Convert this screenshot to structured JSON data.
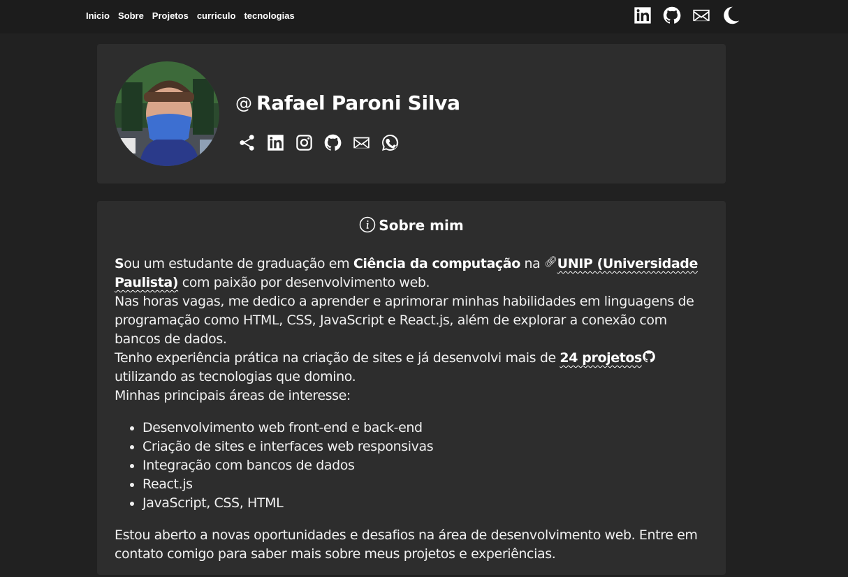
{
  "nav": {
    "items": [
      "Inicio",
      "Sobre",
      "Projetos",
      "curriculo",
      "tecnologias"
    ]
  },
  "header_icons": [
    "linkedin-icon",
    "github-icon",
    "mail-icon",
    "moon-icon"
  ],
  "profile": {
    "at_symbol": "@",
    "name": "Rafael Paroni Silva",
    "social_icons": [
      "share-icon",
      "linkedin-icon",
      "instagram-icon",
      "github-icon",
      "mail-icon",
      "whatsapp-icon"
    ]
  },
  "about": {
    "title": "Sobre mim",
    "p1_first_letter": "S",
    "p1_a": "ou um estudante de graduação em ",
    "p1_bold": "Ciência da computação",
    "p1_b": " na ",
    "p1_link": "UNIP (Universidade Paulista)",
    "p1_c": " com paixão por desenvolvimento web.",
    "p2": "Nas horas vagas, me dedico a aprender e aprimorar minhas habilidades em linguagens de programação como HTML, CSS, JavaScript e React.js, além de explorar a conexão com bancos de dados.",
    "p3_a": "Tenho experiência prática na criação de sites e já desenvolvi mais de ",
    "p3_link": "24 projetos",
    "p3_b": " utilizando as tecnologias que domino.",
    "p4": "Minhas principais áreas de interesse:",
    "interests": [
      "Desenvolvimento web front-end e back-end",
      "Criação de sites e interfaces web responsivas",
      "Integração com bancos de dados",
      "React.js",
      "JavaScript, CSS, HTML"
    ],
    "closing": "Estou aberto a novas oportunidades e desafios na área de desenvolvimento web. Entre em contato comigo para saber mais sobre meus projetos e experiências."
  },
  "colors": {
    "page_bg": "#212121",
    "topbar_bg": "#1c1c1c",
    "card_bg": "#2d2d2d",
    "text": "#ffffff"
  }
}
